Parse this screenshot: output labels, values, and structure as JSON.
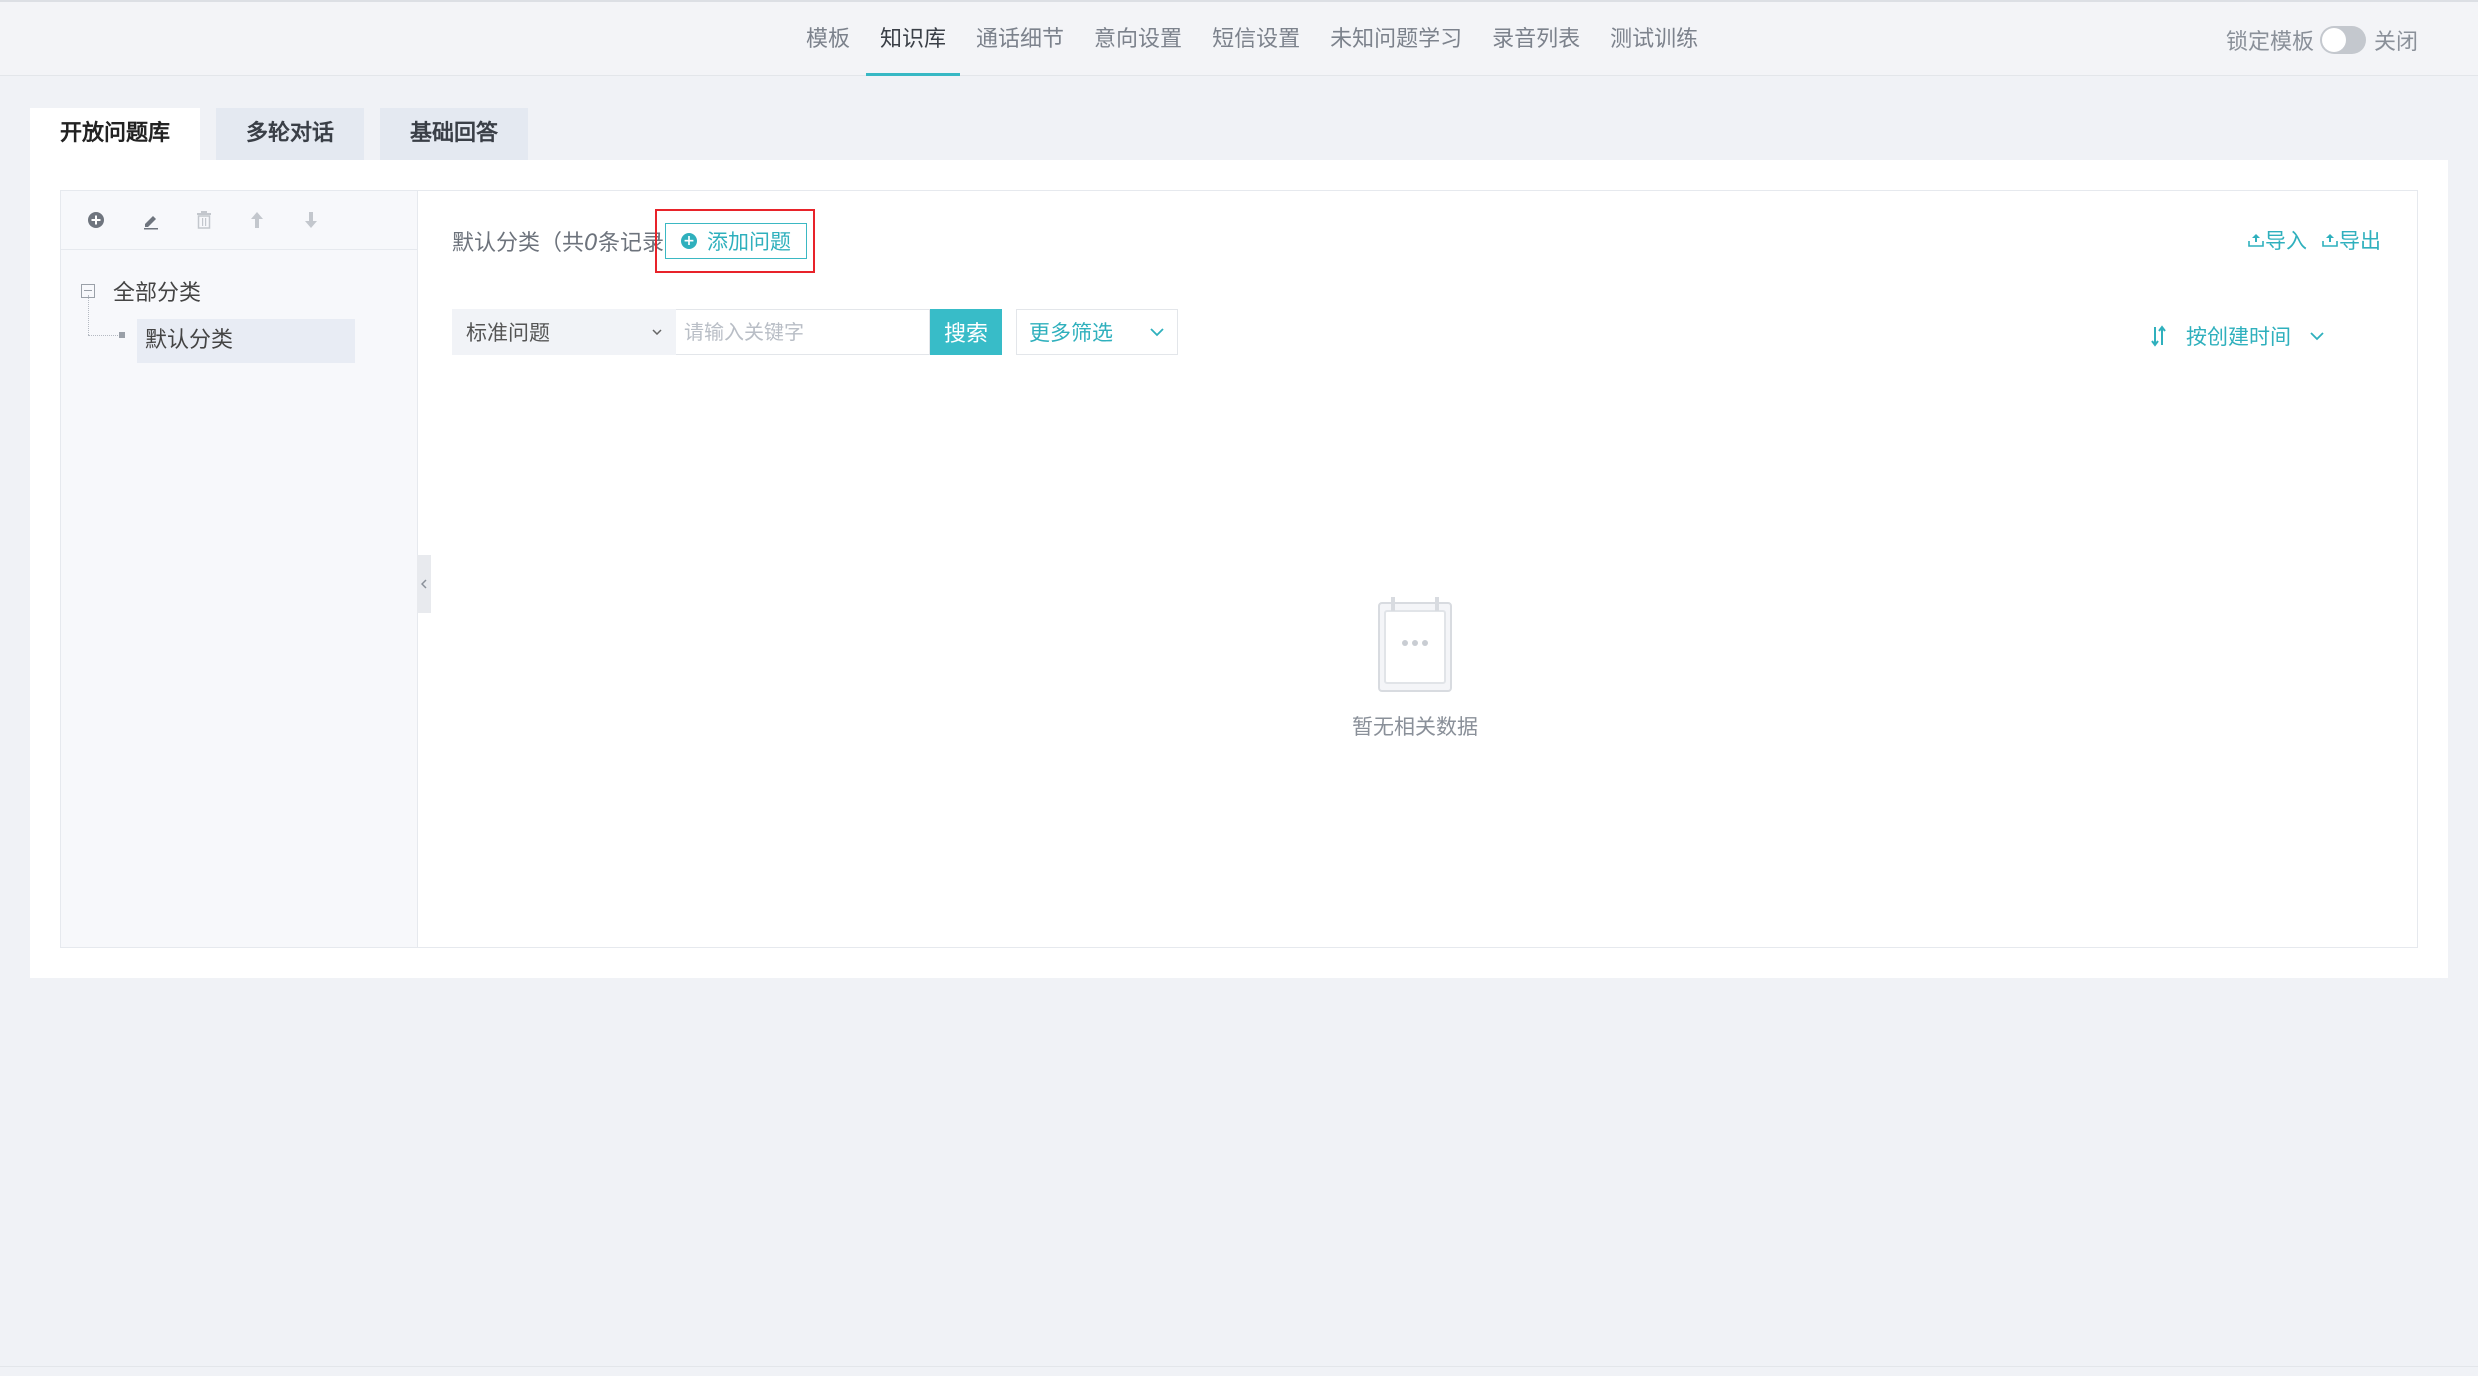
{
  "nav": {
    "items": [
      "模板",
      "知识库",
      "通话细节",
      "意向设置",
      "短信设置",
      "未知问题学习",
      "录音列表",
      "测试训练"
    ],
    "active_index": 1
  },
  "lock": {
    "label": "锁定模板",
    "state_label": "关闭",
    "enabled": false
  },
  "tabs": [
    "开放问题库",
    "多轮对话",
    "基础回答"
  ],
  "sidebar": {
    "tools": [
      "add-circle-icon",
      "edit-icon",
      "delete-icon",
      "arrow-up-icon",
      "arrow-down-icon"
    ],
    "tree_root": "全部分类",
    "tree_child": "默认分类"
  },
  "content": {
    "category_prefix": "默认分类（共",
    "record_count": "0",
    "category_suffix": "条记录）",
    "add_button": "添加问题",
    "import_label": "导入",
    "export_label": "导出",
    "select_value": "标准问题",
    "search_placeholder": "请输入关键字",
    "search_button": "搜索",
    "more_filter": "更多筛选",
    "sort_label": "按创建时间",
    "empty_text": "暂无相关数据"
  },
  "colors": {
    "accent": "#38bcc8",
    "highlight_border": "#e8232a"
  }
}
